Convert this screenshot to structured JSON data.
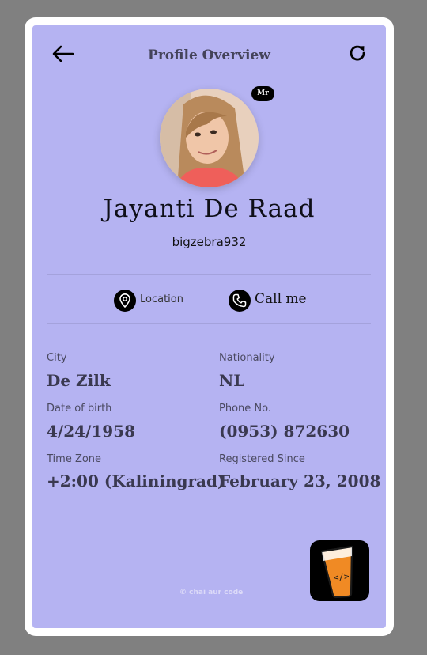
{
  "header": {
    "title": "Profile Overview"
  },
  "profile": {
    "name": "Jayanti De Raad",
    "username": "bigzebra932",
    "title_badge": "Mr"
  },
  "actions": {
    "location_label": "Location",
    "call_label": "Call me"
  },
  "details": {
    "city_label": "City",
    "city_value": "De Zilk",
    "nationality_label": "Nationality",
    "nationality_value": "NL",
    "dob_label": "Date of birth",
    "dob_value": "4/24/1958",
    "phone_label": "Phone No.",
    "phone_value": "(0953) 872630",
    "timezone_label": "Time Zone",
    "timezone_value": "+2:00 (Kaliningrad)",
    "registered_label": "Registered Since",
    "registered_value": "February 23, 2008"
  },
  "footer": {
    "credit": "© chai aur code"
  },
  "icons": {
    "back": "arrow-left-icon",
    "refresh": "refresh-icon",
    "location": "map-pin-icon",
    "phone": "phone-icon",
    "logo": "chai-glass-code-icon"
  },
  "colors": {
    "page_bg": "#808080",
    "card_bg": "#b5b3f2",
    "frame": "#ffffff",
    "accent_dark": "#000000",
    "logo_orange": "#f08a24"
  }
}
